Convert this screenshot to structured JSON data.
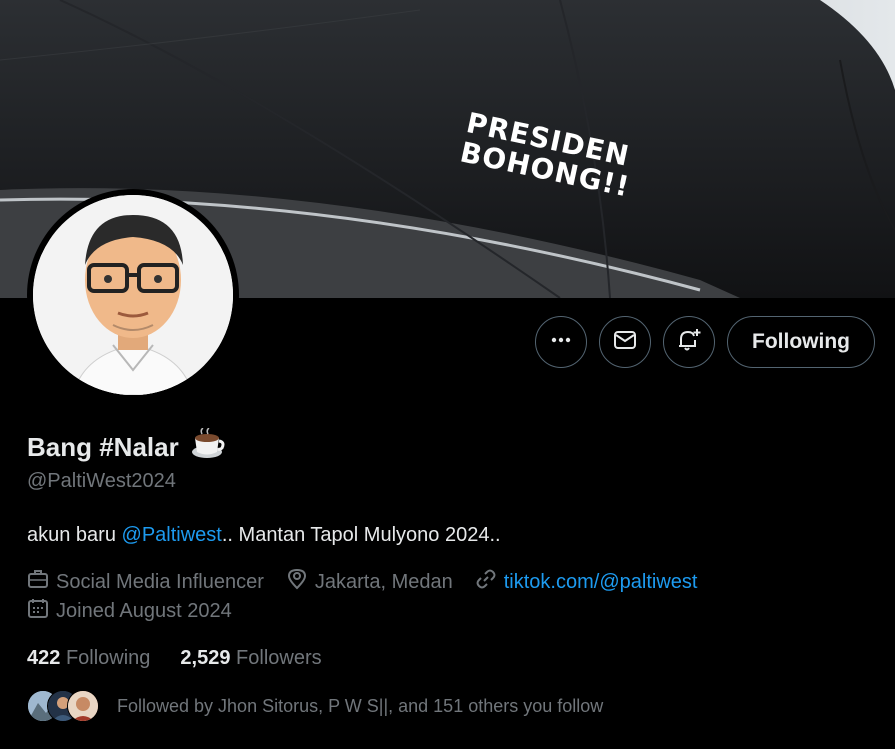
{
  "banner": {
    "text_line1": "PRESIDEN",
    "text_line2": "BOHONG!!"
  },
  "profile": {
    "display_name": "Bang #Nalar",
    "name_emoji": "coffee-cup",
    "handle": "@PaltiWest2024",
    "bio_prefix": "akun baru ",
    "bio_mention": "@Paltiwest",
    "bio_suffix": ".. Mantan Tapol Mulyono 2024..",
    "category": "Social Media Influencer",
    "location": "Jakarta, Medan",
    "website": "tiktok.com/@paltiwest",
    "joined": "Joined August 2024"
  },
  "actions": {
    "more_icon": "more-icon",
    "message_icon": "mail-icon",
    "notify_icon": "bell-plus-icon",
    "follow_label": "Following"
  },
  "stats": {
    "following_count": "422",
    "following_label": "Following",
    "followers_count": "2,529",
    "followers_label": "Followers"
  },
  "followed_by": "Followed by Jhon Sitorus, P W S||, and 151 others you follow",
  "colors": {
    "background": "#000000",
    "link": "#1d9bf0",
    "muted": "#71767b",
    "text": "#e7e9ea",
    "border": "#536471"
  }
}
